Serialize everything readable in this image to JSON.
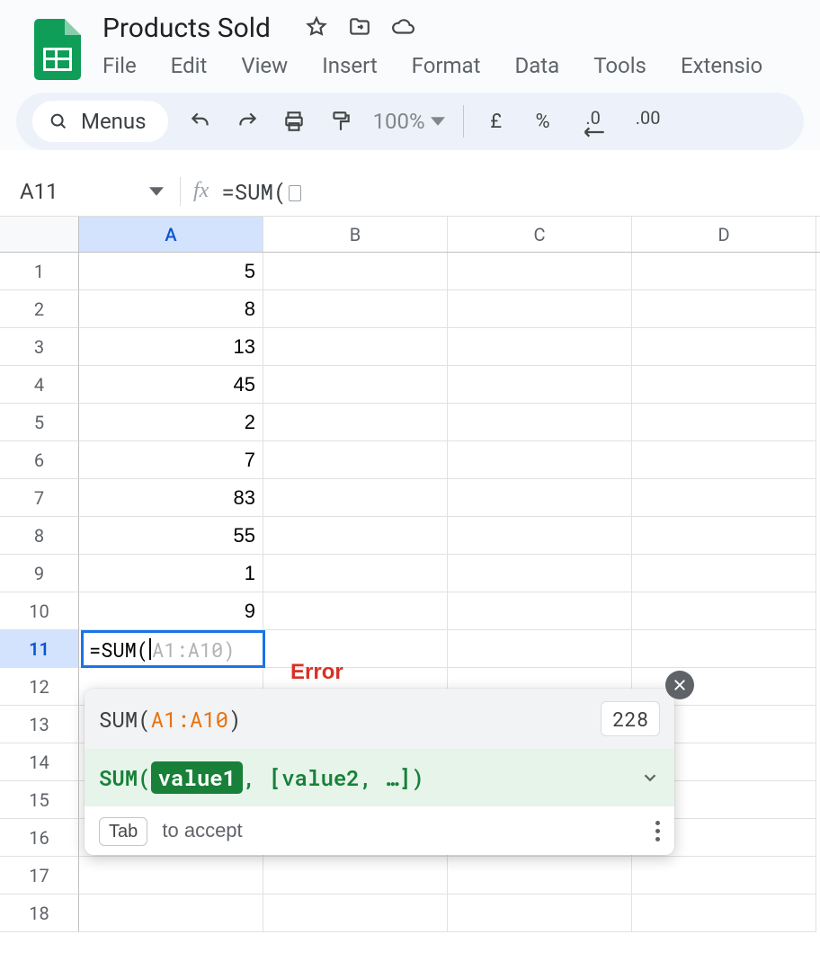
{
  "doc": {
    "title": "Products Sold"
  },
  "menus": {
    "file": "File",
    "edit": "Edit",
    "view": "View",
    "insert": "Insert",
    "format": "Format",
    "data": "Data",
    "tools": "Tools",
    "extensions": "Extensio"
  },
  "toolbar": {
    "menus_label": "Menus",
    "zoom": "100%",
    "currency_symbol": "£",
    "percent_symbol": "%",
    "dec_less": ".0",
    "dec_more": ".00"
  },
  "namebox": {
    "ref": "A11"
  },
  "formula_bar": {
    "text": "=SUM("
  },
  "columns": [
    "A",
    "B",
    "C",
    "D"
  ],
  "row_numbers": [
    1,
    2,
    3,
    4,
    5,
    6,
    7,
    8,
    9,
    10,
    11,
    12,
    13,
    14,
    15,
    16,
    17,
    18
  ],
  "colA_values": [
    "5",
    "8",
    "13",
    "45",
    "2",
    "7",
    "83",
    "55",
    "1",
    "9"
  ],
  "active_cell": {
    "typed": "=SUM(",
    "ghost": "A1:A10)",
    "row_label": "11"
  },
  "error_label": "Error",
  "tooltip": {
    "row1_fn_open": "SUM(",
    "row1_range": "A1:A10",
    "row1_close": ")",
    "result": "228",
    "row2_fn": "SUM(",
    "row2_chip": "value1",
    "row2_rest": ", [value2, …])",
    "tab_key": "Tab",
    "accept_text": "to accept"
  }
}
